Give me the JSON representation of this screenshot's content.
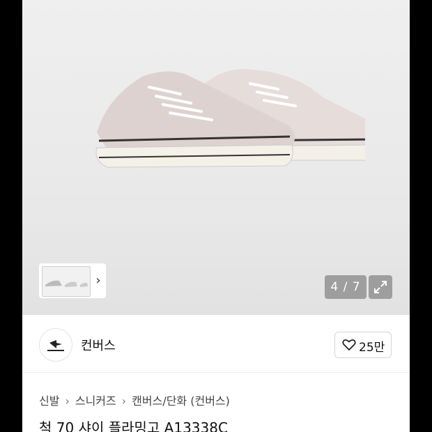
{
  "gallery": {
    "counter": "4 / 7",
    "expand_icon": "expand-icon",
    "thumb_arrow_icon": "chevron-right-icon"
  },
  "shop": {
    "brand": "컨버스",
    "like_icon": "heart-icon",
    "like_count": "25만"
  },
  "breadcrumb": [
    "신발",
    "스니커즈",
    "캔버스/단화 (컨버스)"
  ],
  "product": {
    "title": "척 70 샤이 플라밍고 A13338C"
  }
}
